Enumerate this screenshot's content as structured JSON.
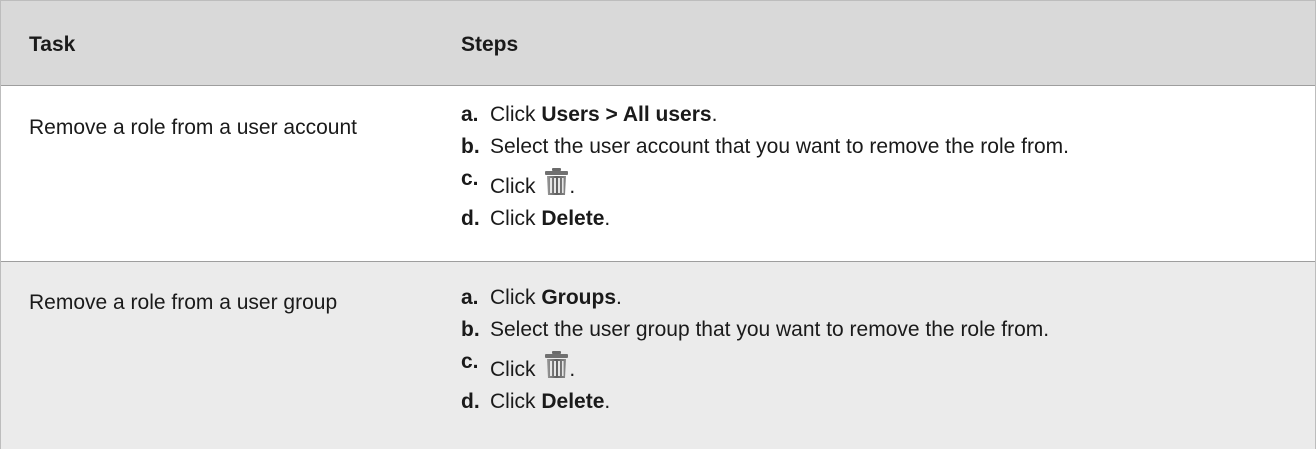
{
  "table": {
    "headers": [
      "Task",
      "Steps"
    ],
    "rows": [
      {
        "task": "Remove a role from a user account",
        "steps": [
          {
            "letter": "a.",
            "pre": "Click ",
            "bold": "Users > All users",
            "post": "."
          },
          {
            "letter": "b.",
            "pre": "Select the user account that you want to remove the role from.",
            "bold": "",
            "post": ""
          },
          {
            "letter": "c.",
            "pre": "Click ",
            "icon": "trash-icon",
            "post": "."
          },
          {
            "letter": "d.",
            "pre": "Click ",
            "bold": "Delete",
            "post": "."
          }
        ]
      },
      {
        "task": "Remove a role from a user group",
        "steps": [
          {
            "letter": "a.",
            "pre": "Click ",
            "bold": "Groups",
            "post": "."
          },
          {
            "letter": "b.",
            "pre": "Select the user group that you want to remove the role from.",
            "bold": "",
            "post": ""
          },
          {
            "letter": "c.",
            "pre": "Click ",
            "icon": "trash-icon",
            "post": "."
          },
          {
            "letter": "d.",
            "pre": "Click ",
            "bold": "Delete",
            "post": "."
          }
        ]
      }
    ]
  },
  "colors": {
    "header_bg": "#d9d9d9",
    "alt_row_bg": "#ebebeb",
    "border": "#bdbdbd"
  }
}
